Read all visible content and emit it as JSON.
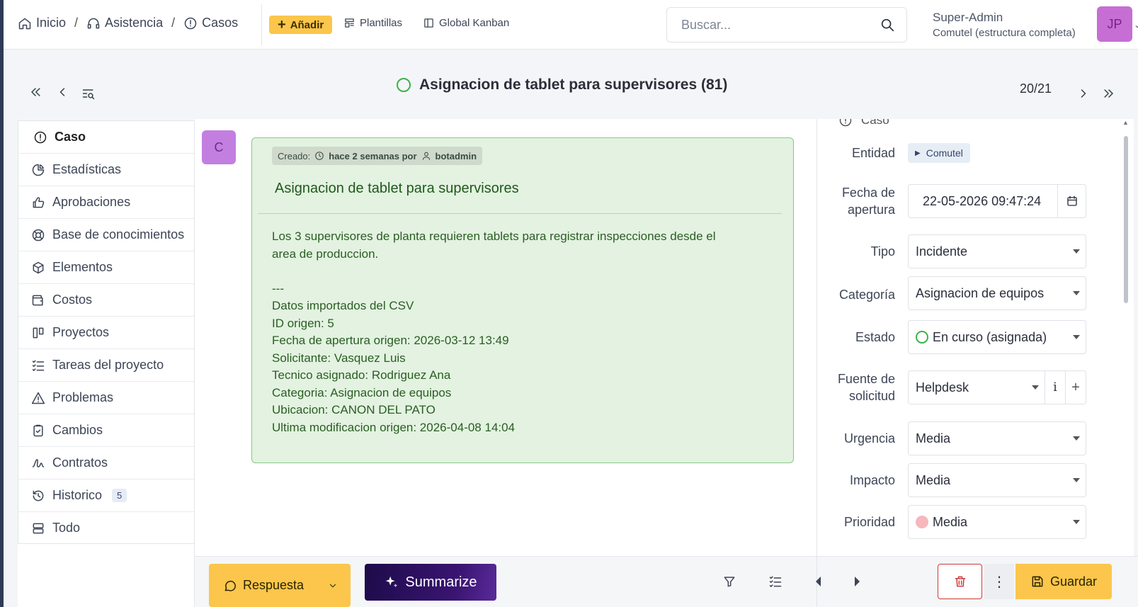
{
  "breadcrumbs": [
    {
      "label": "Inicio",
      "icon": "home-icon"
    },
    {
      "label": "Asistencia",
      "icon": "headset-icon"
    },
    {
      "label": "Casos",
      "icon": "alert-circle-icon"
    }
  ],
  "toolbar": {
    "add_label": "Añadir",
    "templates_label": "Plantillas",
    "kanban_label": "Global Kanban"
  },
  "search": {
    "placeholder": "Buscar...",
    "value": ""
  },
  "user": {
    "name": "Super-Admin",
    "entity": "Comutel (estructura completa)",
    "initials": "JP"
  },
  "ticket": {
    "title": "Asignacion de tablet para supervisores (81)",
    "pager": "20/21"
  },
  "tabs": [
    {
      "label": "Caso",
      "icon": "alert-circle-icon",
      "active": true
    },
    {
      "label": "Estadísticas",
      "icon": "pie-chart-icon"
    },
    {
      "label": "Aprobaciones",
      "icon": "thumbs-up-icon"
    },
    {
      "label": "Base de conocimientos",
      "icon": "lifebuoy-icon"
    },
    {
      "label": "Elementos",
      "icon": "package-icon"
    },
    {
      "label": "Costos",
      "icon": "wallet-icon"
    },
    {
      "label": "Proyectos",
      "icon": "columns-icon"
    },
    {
      "label": "Tareas del proyecto",
      "icon": "checklist-icon"
    },
    {
      "label": "Problemas",
      "icon": "warning-icon"
    },
    {
      "label": "Cambios",
      "icon": "clipboard-check-icon"
    },
    {
      "label": "Contratos",
      "icon": "signature-icon"
    },
    {
      "label": "Historico",
      "icon": "history-icon",
      "badge": "5"
    },
    {
      "label": "Todo",
      "icon": "stack-icon"
    }
  ],
  "timeline": {
    "author_initial": "C",
    "created_label": "Creado:",
    "created_when": "hace 2 semanas por",
    "created_by": "botadmin",
    "title": "Asignacion de tablet para supervisores",
    "body": "Los 3 supervisores de planta requieren tablets para registrar inspecciones desde el\narea de produccion.\n\n---\nDatos importados del CSV\nID origen: 5\nFecha de apertura origen: 2026-03-12 13:49\nSolicitante: Vasquez Luis\nTecnico asignado: Rodriguez Ana\nCategoria: Asignacion de equipos\nUbicacion: CANON DEL PATO\nUltima modificacion origen: 2026-04-08 14:04"
  },
  "form": {
    "section_label": "Caso",
    "entity_label": "Entidad",
    "entity_value": "Comutel",
    "open_date_label": "Fecha de apertura",
    "open_date_value": "22-05-2026 09:47:24",
    "type_label": "Tipo",
    "type_value": "Incidente",
    "category_label": "Categoría",
    "category_value": "Asignacion de equipos",
    "status_label": "Estado",
    "status_value": "En curso (asignada)",
    "source_label": "Fuente de solicitud",
    "source_value": "Helpdesk",
    "urgency_label": "Urgencia",
    "urgency_value": "Media",
    "impact_label": "Impacto",
    "impact_value": "Media",
    "priority_label": "Prioridad",
    "priority_value": "Media"
  },
  "bottom": {
    "reply_label": "Respuesta",
    "summarize_label": "Summarize",
    "save_label": "Guardar"
  },
  "colors": {
    "accent": "#fbc64b",
    "status_green": "#3ab34a",
    "bubble_bg": "#e3f2e1",
    "bubble_border": "#8ac987",
    "priority_medium": "#f6b7bd",
    "danger": "#d03a3a"
  }
}
